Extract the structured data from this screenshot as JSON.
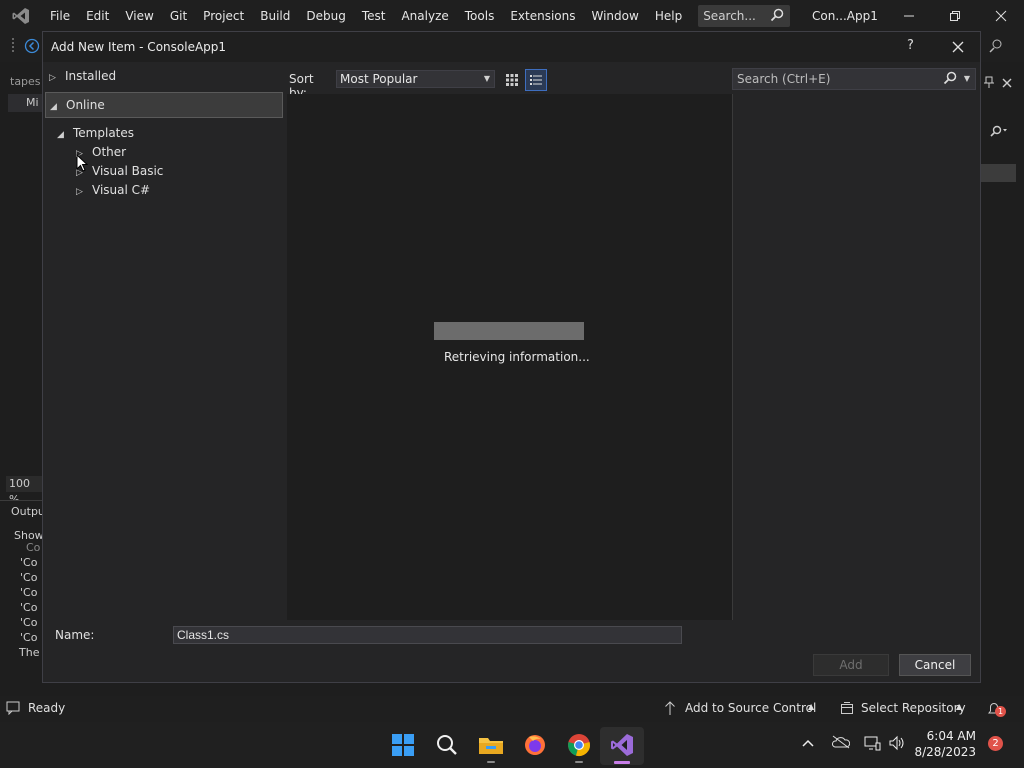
{
  "menubar": {
    "items": [
      "File",
      "Edit",
      "View",
      "Git",
      "Project",
      "Build",
      "Debug",
      "Test",
      "Analyze",
      "Tools",
      "Extensions",
      "Window",
      "Help"
    ],
    "search_placeholder": "Search...",
    "solution_name": "Con...App1"
  },
  "ide": {
    "tab_label": "tapes",
    "mini_row": "Mi",
    "zoom": "100 %",
    "output_title": "Outpu",
    "output_lines": [
      "Show",
      "Co",
      "'Co",
      "'Co",
      "'Co",
      "'Co",
      "'Co",
      "'Co",
      "The"
    ]
  },
  "dialog": {
    "title": "Add New Item - ConsoleApp1",
    "help_label": "?",
    "tree": {
      "installed": "Installed",
      "online": "Online",
      "templates": "Templates",
      "other": "Other",
      "visual_basic": "Visual Basic",
      "visual_csharp": "Visual C#"
    },
    "sort_by_label": "Sort by:",
    "sort_by_value": "Most Popular",
    "search_placeholder": "Search (Ctrl+E)",
    "loading_text": "Retrieving information...",
    "progress_fraction": 1.0,
    "name_label": "Name:",
    "name_value": "Class1.cs",
    "add_label": "Add",
    "cancel_label": "Cancel"
  },
  "status_bar": {
    "ready": "Ready",
    "add_to_source_control": "Add to Source Control",
    "select_repository": "Select Repository",
    "notification_count": "1"
  },
  "taskbar": {
    "time": "6:04 AM",
    "date": "8/28/2023",
    "badge_count": "2"
  },
  "colors": {
    "accent": "#3e6ebf",
    "vs_purple": "#9b6bd9",
    "background": "#1e1e1e"
  },
  "icons": [
    "vs-logo-icon",
    "search-icon",
    "minimize-icon",
    "restore-icon",
    "close-icon",
    "grid-view-icon",
    "list-view-icon",
    "windows-start-icon",
    "file-explorer-icon",
    "firefox-icon",
    "chrome-icon",
    "visual-studio-icon"
  ]
}
